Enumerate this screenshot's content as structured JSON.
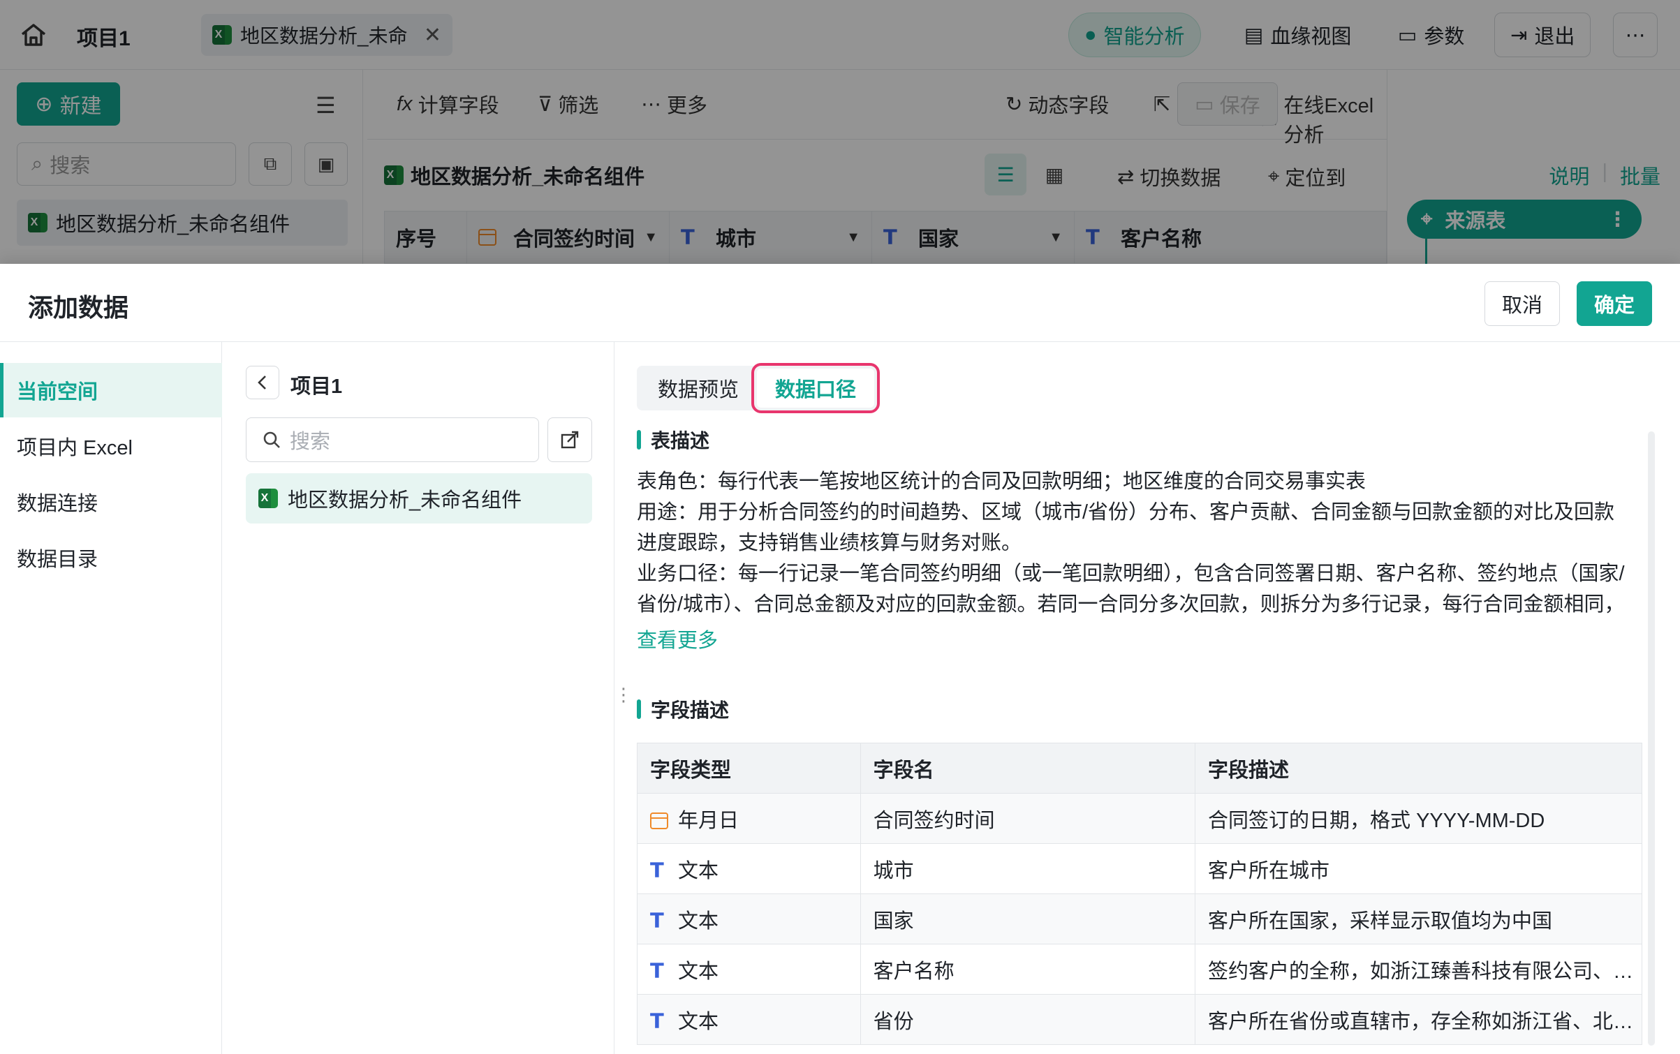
{
  "topbar": {
    "project": "项目1",
    "file_tab": "地区数据分析_未命",
    "ai_analysis": "智能分析",
    "lineage": "血缘视图",
    "params": "参数",
    "exit": "退出"
  },
  "left": {
    "new_btn": "新建",
    "search_placeholder": "搜索",
    "item": "地区数据分析_未命名组件"
  },
  "toolbar": {
    "calc_field": "计算字段",
    "filter": "筛选",
    "more1": "更多",
    "dynamic_field": "动态字段",
    "export": "导出",
    "online_excel": "在线Excel分析",
    "more2": "更多",
    "save": "保存"
  },
  "widget": {
    "title": "地区数据分析_未命名组件",
    "switch_data": "切换数据",
    "locate": "定位到",
    "columns": [
      "序号",
      "合同签约时间",
      "城市",
      "国家",
      "客户名称"
    ]
  },
  "right": {
    "explain": "说明",
    "batch": "批量",
    "source": "来源表"
  },
  "drawer": {
    "title": "添加数据",
    "cancel": "取消",
    "confirm": "确定",
    "nav": [
      "当前空间",
      "项目内 Excel",
      "数据连接",
      "数据目录"
    ],
    "mid_title": "项目1",
    "mid_search_placeholder": "搜索",
    "mid_item": "地区数据分析_未命名组件",
    "tabs": [
      "数据预览",
      "数据口径"
    ],
    "table_desc_title": "表描述",
    "desc_lines": [
      "表角色：每行代表一笔按地区统计的合同及回款明细；地区维度的合同交易事实表",
      "用途：用于分析合同签约的时间趋势、区域（城市/省份）分布、客户贡献、合同金额与回款金额的对比及回款进度跟踪，支持销售业绩核算与财务对账。",
      "业务口径：每一行记录一笔合同签约明细（或一笔回款明细），包含合同签署日期、客户名称、签约地点（国家/省份/城市）、合同总金额及对应的回款金额。若同一合同分多次回款，则拆分为多行记录，每行合同金额相同，回款金"
    ],
    "see_more": "查看更多",
    "field_desc_title": "字段描述",
    "field_headers": [
      "字段类型",
      "字段名",
      "字段描述"
    ],
    "fields": [
      {
        "type": "年月日",
        "icon": "calendar-icon",
        "name": "合同签约时间",
        "desc": "合同签订的日期，格式 YYYY-MM-DD"
      },
      {
        "type": "文本",
        "icon": "text-type-icon",
        "name": "城市",
        "desc": "客户所在城市"
      },
      {
        "type": "文本",
        "icon": "text-type-icon",
        "name": "国家",
        "desc": "客户所在国家，采样显示取值均为中国"
      },
      {
        "type": "文本",
        "icon": "text-type-icon",
        "name": "客户名称",
        "desc": "签约客户的全称，如浙江臻善科技有限公司、…"
      },
      {
        "type": "文本",
        "icon": "text-type-icon",
        "name": "省份",
        "desc": "客户所在省份或直辖市，存全称如浙江省、北…"
      }
    ]
  }
}
